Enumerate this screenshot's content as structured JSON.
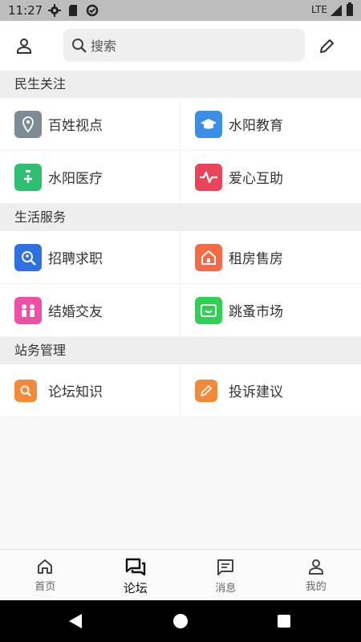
{
  "status_bar": {
    "time": "11:27",
    "network": "LTE"
  },
  "topbar": {
    "search_placeholder": "搜索"
  },
  "sections": [
    {
      "title": "民生关注",
      "items": [
        {
          "label": "百姓视点",
          "icon": "location-pin-icon",
          "color": "#7d8b94"
        },
        {
          "label": "水阳教育",
          "icon": "graduation-cap-icon",
          "color": "#3a8ee6"
        },
        {
          "label": "水阳医疗",
          "icon": "medical-kit-icon",
          "color": "#2fbf71"
        },
        {
          "label": "爱心互助",
          "icon": "heartbeat-icon",
          "color": "#e8445a"
        }
      ]
    },
    {
      "title": "生活服务",
      "items": [
        {
          "label": "招聘求职",
          "icon": "job-search-icon",
          "color": "#2f6fe0"
        },
        {
          "label": "租房售房",
          "icon": "house-icon",
          "color": "#f46a45"
        },
        {
          "label": "结婚交友",
          "icon": "couple-icon",
          "color": "#f04fa6"
        },
        {
          "label": "跳蚤市场",
          "icon": "market-icon",
          "color": "#2fd155"
        }
      ]
    },
    {
      "title": "站务管理",
      "items": [
        {
          "label": "论坛知识",
          "icon": "search-icon",
          "color": "#f4893a"
        },
        {
          "label": "投诉建议",
          "icon": "edit-icon",
          "color": "#f4893a"
        }
      ]
    }
  ],
  "bottom_nav": [
    {
      "label": "首页",
      "icon": "home-icon"
    },
    {
      "label": "论坛",
      "icon": "forum-icon",
      "active": true
    },
    {
      "label": "消息",
      "icon": "message-icon"
    },
    {
      "label": "我的",
      "icon": "profile-icon"
    }
  ]
}
